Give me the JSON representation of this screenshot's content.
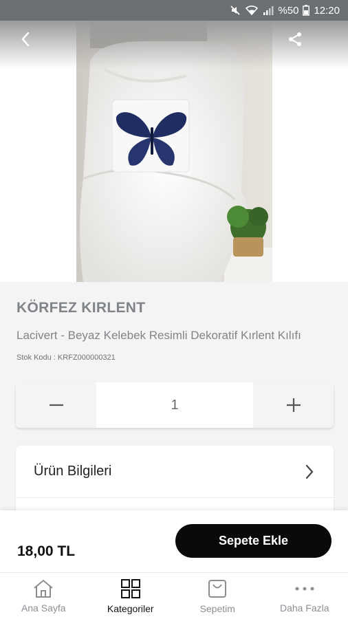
{
  "status_bar": {
    "battery": "%50",
    "time": "12:20"
  },
  "product": {
    "brand": "KÖRFEZ KIRLENT",
    "title": "Lacivert - Beyaz Kelebek Resimli Dekoratif Kırlent Kılıfı",
    "stock_code": "Stok Kodu : KRFZ000000321",
    "quantity": "1",
    "price": "18,00 TL"
  },
  "actions": {
    "add_to_cart": "Sepete Ekle"
  },
  "info_rows": [
    {
      "label": "Ürün Bilgileri"
    }
  ],
  "nav": [
    {
      "label": "Ana Sayfa",
      "icon": "home-icon"
    },
    {
      "label": "Kategoriler",
      "icon": "grid-icon",
      "active": true
    },
    {
      "label": "Sepetim",
      "icon": "bag-icon"
    },
    {
      "label": "Daha Fazla",
      "icon": "more-icon"
    }
  ]
}
